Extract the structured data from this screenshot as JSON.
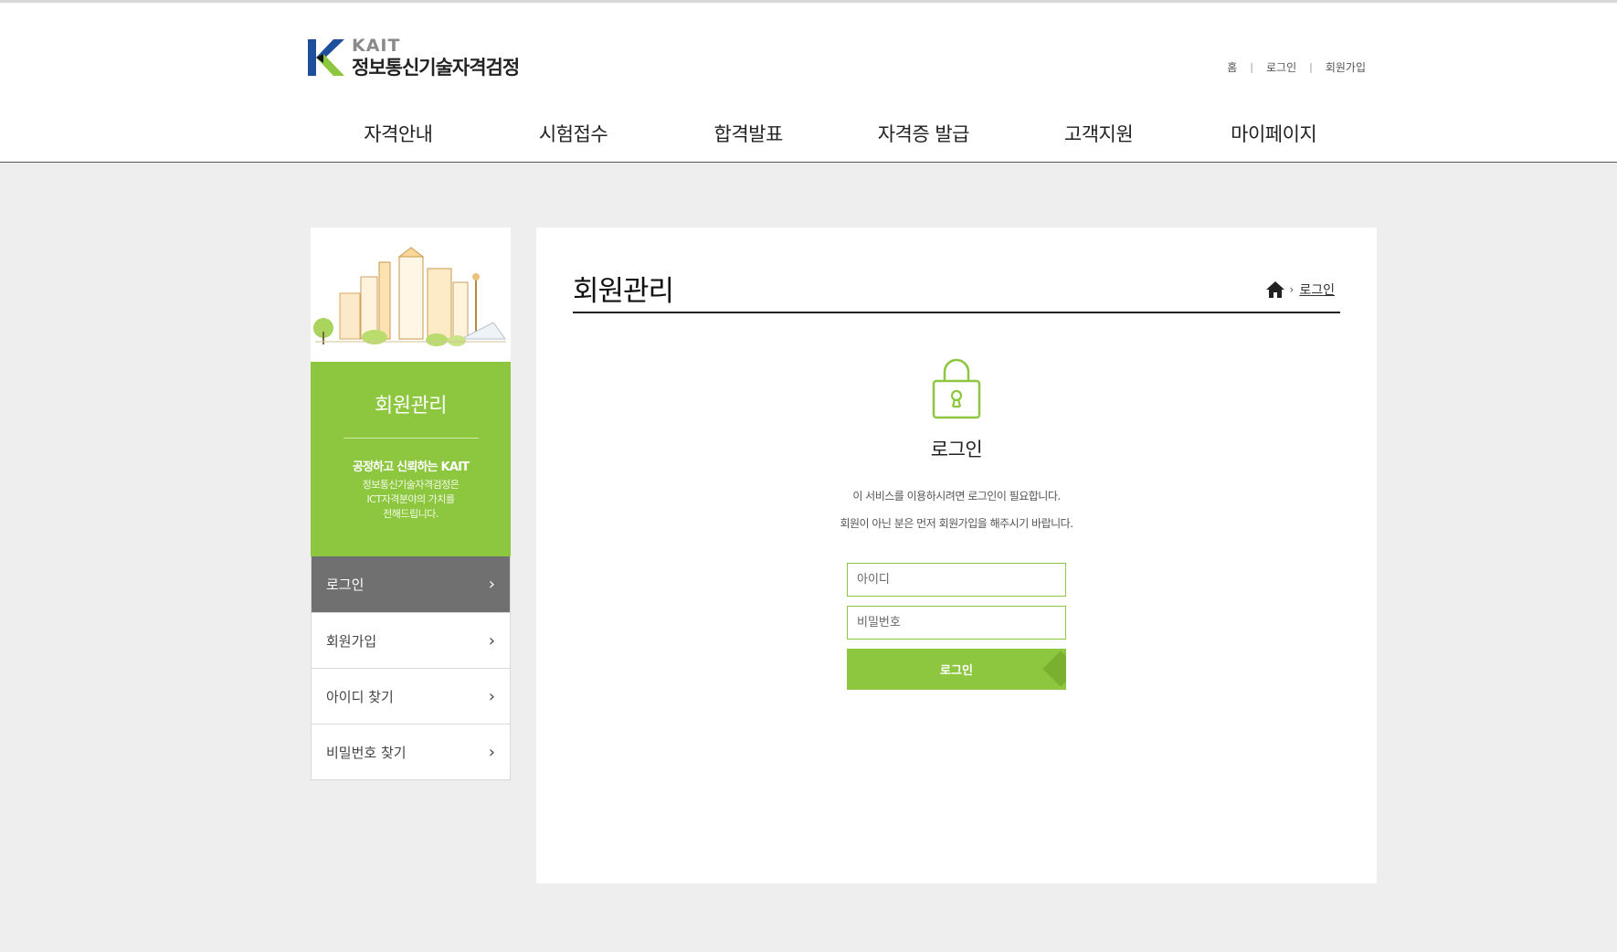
{
  "header": {
    "logo": {
      "brand": "KAIT",
      "name": "정보통신기술자격검정"
    },
    "util_links": [
      "홈",
      "로그인",
      "회원가입"
    ],
    "nav": [
      "자격안내",
      "시험접수",
      "합격발표",
      "자격증 발급",
      "고객지원",
      "마이페이지"
    ]
  },
  "sidebar": {
    "title": "회원관리",
    "slogan": "공정하고 신뢰하는 KAIT",
    "desc": [
      "정보통신기술자격검정은",
      "ICT자격분야의 가치를",
      "전해드립니다."
    ],
    "menu": [
      {
        "label": "로그인",
        "active": true
      },
      {
        "label": "회원가입",
        "active": false
      },
      {
        "label": "아이디 찾기",
        "active": false
      },
      {
        "label": "비밀번호 찾기",
        "active": false
      }
    ]
  },
  "main": {
    "title": "회원관리",
    "breadcrumb": {
      "current": "로그인"
    },
    "login": {
      "title": "로그인",
      "messages": [
        "이 서비스를 이용하시려면 로그인이 필요합니다.",
        "회원이 아닌 분은 먼저 회원가입을 해주시기 바랍니다."
      ],
      "id_placeholder": "아이디",
      "pw_placeholder": "비밀번호",
      "button": "로그인"
    }
  },
  "colors": {
    "accent": "#8dc63f",
    "active_menu": "#707070",
    "background": "#eeeeee"
  }
}
